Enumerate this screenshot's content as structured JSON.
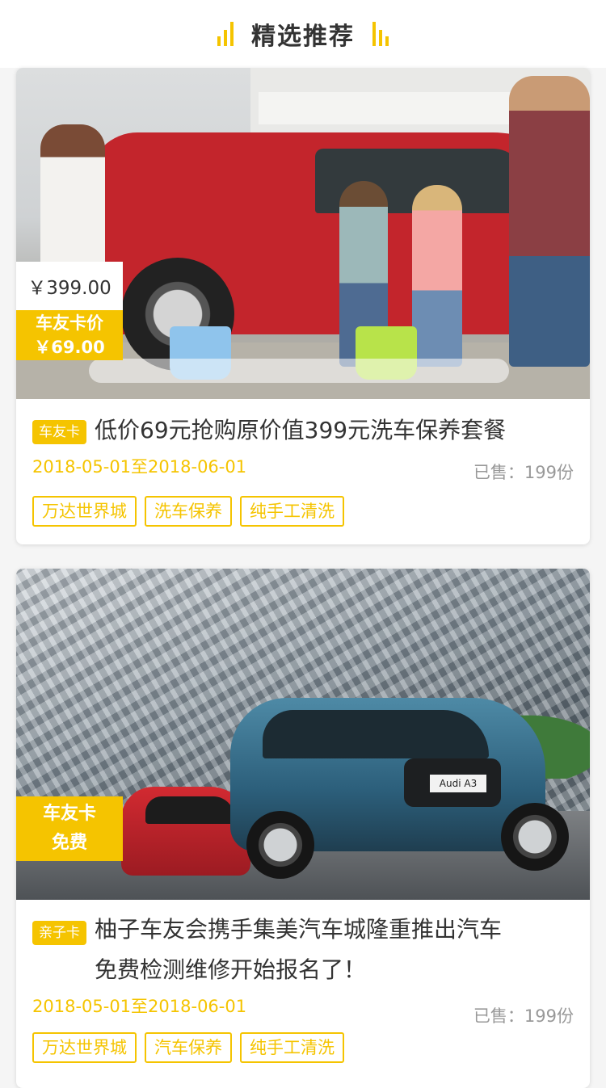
{
  "header": {
    "title": "精选推荐"
  },
  "cards": [
    {
      "price_original": "￥399.00",
      "member_label": "车友卡价",
      "member_price": "￥69.00",
      "badge": "车友卡",
      "title": "低价69元抢购原价值399元洗车保养套餐",
      "date_range": "2018-05-01至2018-06-01",
      "sold": "已售：199份",
      "tags": [
        "万达世界城",
        "洗车保养",
        "纯手工清洗"
      ]
    },
    {
      "member_label": "车友卡",
      "member_price": "免费",
      "badge": "亲子卡",
      "title_line1": "柚子车友会携手集美汽车城隆重推出汽车",
      "title_line2": "免费检测维修开始报名了！",
      "date_range": "2018-05-01至2018-06-01",
      "sold": "已售：199份",
      "tags": [
        "万达世界城",
        "汽车保养",
        "纯手工清洗"
      ],
      "car_plate": "Audi A3"
    }
  ],
  "colors": {
    "accent": "#f5c400",
    "text": "#333333",
    "muted": "#999999"
  }
}
